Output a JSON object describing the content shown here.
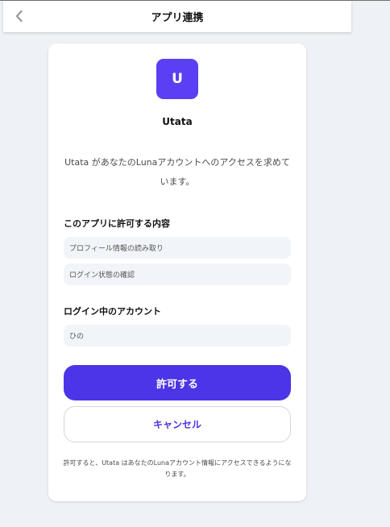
{
  "header": {
    "title": "アプリ連携",
    "back_icon": "chevron-left-icon"
  },
  "app": {
    "icon_letter": "U",
    "icon_color": "#5b3ff2",
    "name": "Utata"
  },
  "request_text": "Utata があなたのLunaアカウントへのアクセスを求めています。",
  "permissions": {
    "title": "このアプリに許可する内容",
    "items": [
      "プロフィール情報の読み取り",
      "ログイン状態の確認"
    ]
  },
  "account": {
    "title": "ログイン中のアカウント",
    "name": "ひの"
  },
  "actions": {
    "allow_label": "許可する",
    "cancel_label": "キャンセル",
    "accent_color": "#4b35e6"
  },
  "footer_note": "許可すると、Utata はあなたのLunaアカウント情報にアクセスできるようになります。"
}
